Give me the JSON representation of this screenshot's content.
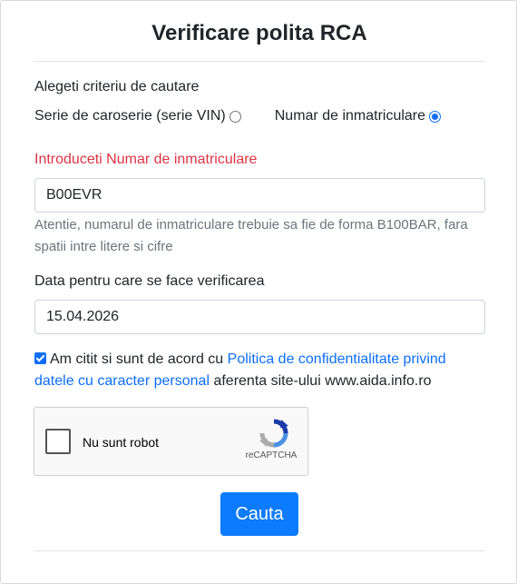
{
  "form": {
    "title": "Verificare polita RCA",
    "criteria_label": "Alegeti criteriu de cautare",
    "radio_vin_label": "Serie de caroserie (serie VIN)",
    "radio_plate_label": "Numar de inmatriculare",
    "selected_criteria": "Numar de inmatriculare",
    "plate_label": "Introduceti Numar de inmatriculare",
    "plate_value": "B00EVR",
    "plate_help": "Atentie, numarul de inmatriculare trebuie sa fie de forma B100BAR, fara spatii intre litere si cifre",
    "date_label": "Data pentru care se face verificarea",
    "date_value": "15.04.2026",
    "consent_prefix": "Am citit si sunt de acord cu",
    "consent_link": "Politica de confidentialitate privind datele cu caracter personal",
    "consent_suffix": "aferenta site-ului www.aida.info.ro",
    "consent_checked": true,
    "submit_label": "Cauta"
  },
  "captcha": {
    "label": "Nu sunt robot",
    "brand": "reCAPTCHA"
  },
  "colors": {
    "accent": "#0d6efd",
    "button": "#0d7bfd",
    "error": "#dc3545",
    "help": "#6c757d"
  }
}
